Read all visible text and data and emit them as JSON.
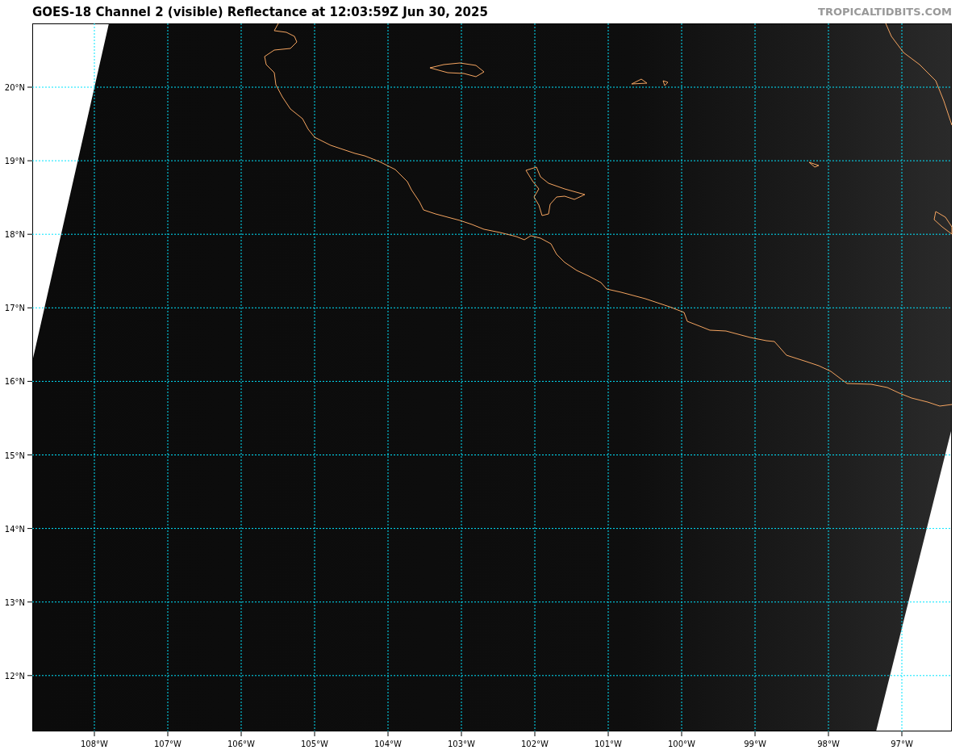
{
  "title": "GOES-18 Channel 2 (visible) Reflectance at 12:03:59Z Jun 30, 2025",
  "watermark": "TROPICALTIDBITS.COM",
  "latitude_labels": [
    "20°N",
    "19°N",
    "18°N",
    "17°N",
    "16°N",
    "15°N",
    "14°N",
    "13°N",
    "12°N"
  ],
  "longitude_labels": [
    "108°W",
    "107°W",
    "106°W",
    "105°W",
    "104°W",
    "103°W",
    "102°W",
    "101°W",
    "100°W",
    "99°W",
    "98°W",
    "97°W"
  ]
}
